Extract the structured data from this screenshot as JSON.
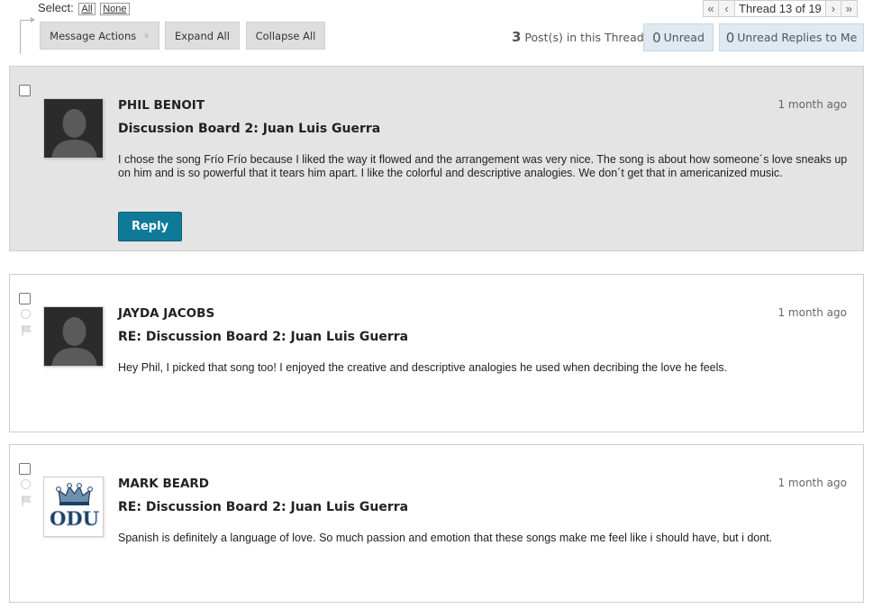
{
  "toolbar": {
    "select_label": "Select:",
    "select_all": "All",
    "select_none": "None",
    "message_actions": "Message Actions",
    "expand_all": "Expand All",
    "collapse_all": "Collapse All"
  },
  "thread_nav": {
    "label": "Thread 13 of 19",
    "first_icon": "double-chevron-left-icon",
    "prev_icon": "chevron-left-icon",
    "next_icon": "chevron-right-icon",
    "last_icon": "double-chevron-right-icon"
  },
  "stats": {
    "post_count": "3",
    "post_count_label": "Post(s) in this Thread",
    "unread_count": "0",
    "unread_label": "Unread",
    "unread_replies_count": "0",
    "unread_replies_label": "Unread Replies to Me"
  },
  "posts": [
    {
      "author": "PHIL BENOIT",
      "subject": "Discussion Board 2: Juan Luis Guerra",
      "time": "1 month ago",
      "body": "I chose the song Frío Frío because I liked the way it flowed and the arrangement was very nice. The song is about how someone´s love sneaks up on him and is so powerful that it tears him apart. I like the colorful and descriptive analogies. We don´t get that in americanized music.",
      "reply_label": "Reply"
    },
    {
      "author": "JAYDA JACOBS",
      "subject": "RE: Discussion Board 2: Juan Luis Guerra",
      "time": "1 month ago",
      "body": "Hey Phil, I picked that song too! I enjoyed the creative and descriptive analogies he used when decribing the love he feels."
    },
    {
      "author": "MARK BEARD",
      "subject": "RE: Discussion Board 2: Juan Luis Guerra",
      "time": "1 month ago",
      "body": "Spanish is definitely a language of love. So much passion and emotion that these songs make me feel like i should have, but i dont.",
      "avatar_text": "ODU"
    }
  ],
  "colors": {
    "reply_button": "#0e7a98",
    "selected_post_bg": "#e4e4e4",
    "unread_pill_bg": "#dfe9f1"
  }
}
